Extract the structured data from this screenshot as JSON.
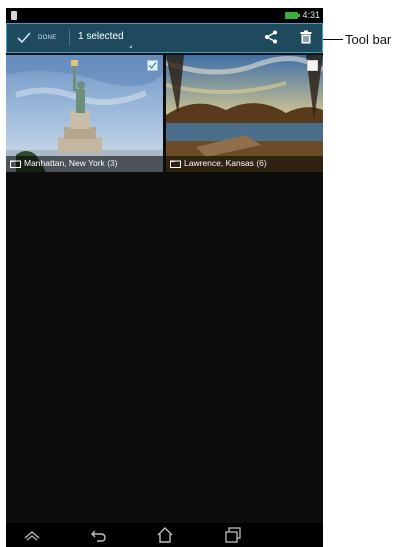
{
  "status_bar": {
    "time": "4:31"
  },
  "action_bar": {
    "done_label": "DONE",
    "selection_label": "1 selected",
    "actions": [
      {
        "icon": "share-icon",
        "label": "Share"
      },
      {
        "icon": "trash-icon",
        "label": "Delete"
      }
    ],
    "colors": {
      "background": "#1f4a5e",
      "border": "#30a5c9"
    }
  },
  "callout": {
    "label": "Tool bar"
  },
  "albums": [
    {
      "name": "Manhattan, New York",
      "count": "(3)",
      "selected": true
    },
    {
      "name": "Lawrence, Kansas",
      "count": "(6)",
      "selected": false
    }
  ],
  "nav_bar": {
    "buttons": [
      "recent-up-icon",
      "back-icon",
      "home-icon",
      "recent-apps-icon"
    ]
  }
}
